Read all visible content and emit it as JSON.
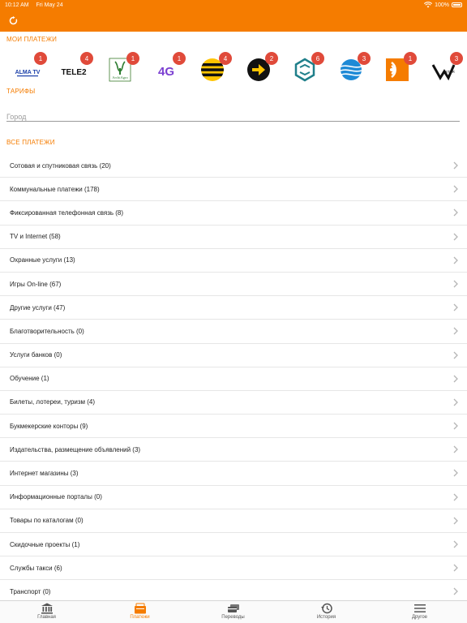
{
  "status_bar": {
    "time": "10:12 AM",
    "date": "Fri May 24",
    "battery": "100%"
  },
  "colors": {
    "accent": "#f57c00",
    "badge": "#e04a3a",
    "divider": "#e6e6e6"
  },
  "sections": {
    "my_payments": "МОИ ПЛАТЕЖИ",
    "tariffs": "ТАРИФЫ",
    "all_payments": "ВСЕ ПЛАТЕЖИ"
  },
  "providers": [
    {
      "logo_text": "ALMA TV",
      "badge": "1",
      "icon": "alma-tv-logo"
    },
    {
      "logo_text": "TELE2",
      "badge": "4",
      "icon": "tele2-logo"
    },
    {
      "logo_text": "ArchiAgro",
      "badge": "1",
      "icon": "archi-logo"
    },
    {
      "logo_text": "4G",
      "badge": "1",
      "icon": "4g-logo"
    },
    {
      "logo_text": "",
      "badge": "4",
      "icon": "beeline-logo"
    },
    {
      "logo_text": "",
      "badge": "2",
      "icon": "arrow-logo"
    },
    {
      "logo_text": "",
      "badge": "6",
      "icon": "hex-logo"
    },
    {
      "logo_text": "",
      "badge": "3",
      "icon": "globe-logo"
    },
    {
      "logo_text": "",
      "badge": "1",
      "icon": "signal-logo"
    },
    {
      "logo_text": "STAR",
      "badge": "3",
      "icon": "star-logo"
    }
  ],
  "search": {
    "placeholder": "Город"
  },
  "categories": [
    "Сотовая и спутниковая связь (20)",
    "Коммунальные платежи (178)",
    "Фиксированная телефонная связь (8)",
    "TV и Internet (58)",
    "Охранные услуги (13)",
    "Игры On-line (67)",
    "Другие услуги (47)",
    "Благотворительность (0)",
    "Услуги банков (0)",
    "Обучение (1)",
    "Билеты, лотереи, туризм (4)",
    "Букмекерские конторы (9)",
    "Издательства, размещение объявлений (3)",
    "Интернет магазины (3)",
    "Информационные порталы (0)",
    "Товары по каталогам (0)",
    "Скидочные проекты (1)",
    "Службы такси (6)",
    "Транспорт (0)"
  ],
  "tabs": [
    {
      "label": "Главная",
      "icon": "bank-icon"
    },
    {
      "label": "Платежи",
      "icon": "wallet-icon"
    },
    {
      "label": "Переводы",
      "icon": "transfer-icon"
    },
    {
      "label": "История",
      "icon": "history-icon"
    },
    {
      "label": "Другое",
      "icon": "menu-icon"
    }
  ]
}
